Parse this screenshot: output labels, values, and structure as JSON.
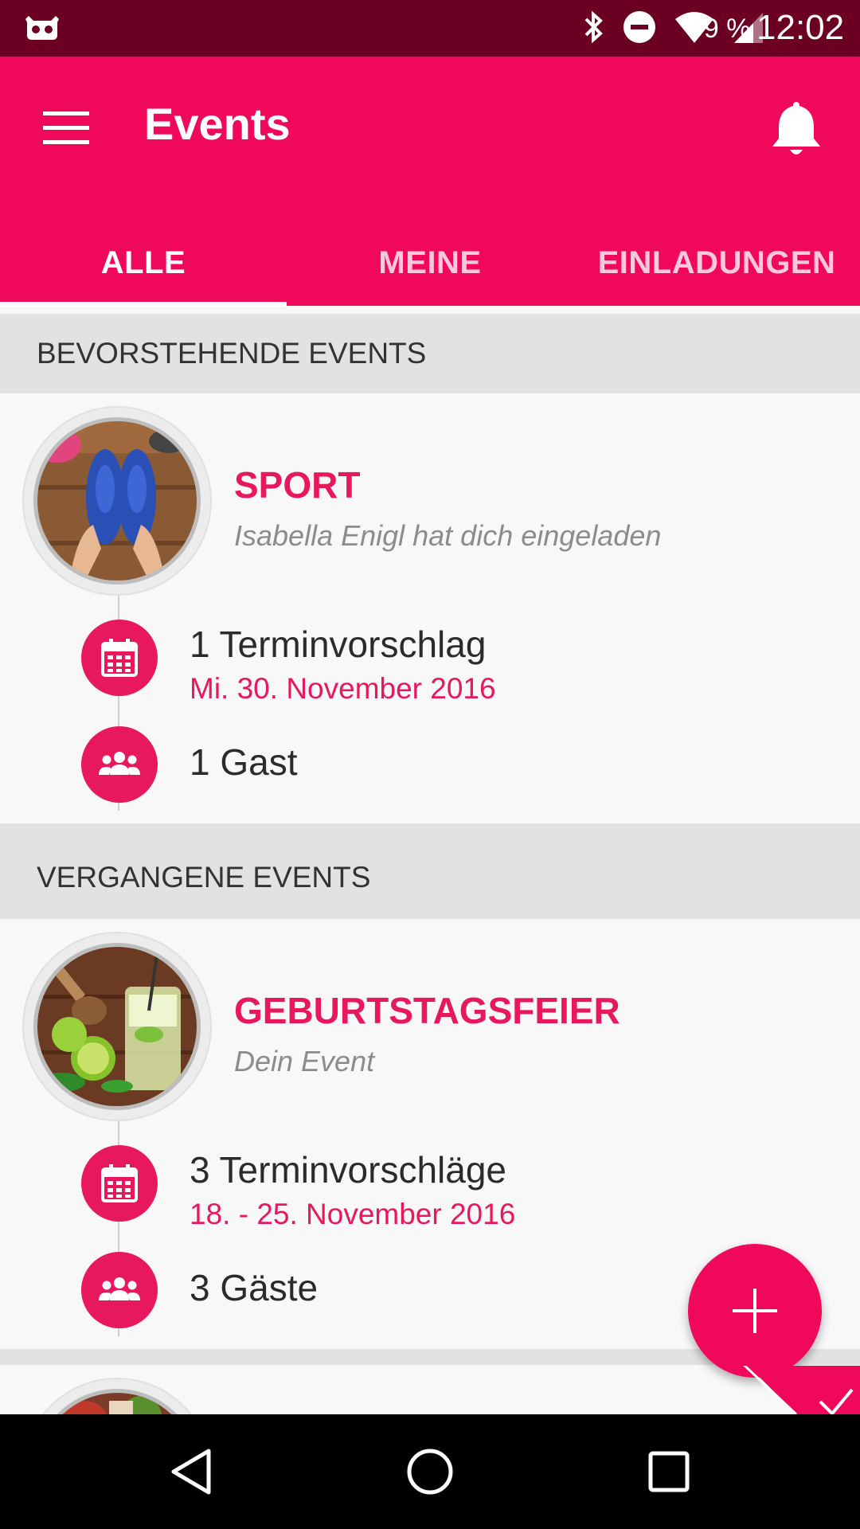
{
  "status_bar": {
    "battery_text": "99 %",
    "time": "12:02",
    "icons": [
      "cyanogen-icon",
      "bluetooth-icon",
      "do-not-disturb-icon",
      "wifi-icon",
      "cell-signal-icon"
    ]
  },
  "app_bar": {
    "title": "Events",
    "menu_icon": "hamburger-menu-icon",
    "notifications_icon": "bell-icon",
    "background": "#f0085a"
  },
  "tabs": [
    {
      "label": "ALLE",
      "active": true
    },
    {
      "label": "MEINE",
      "active": false
    },
    {
      "label": "EINLADUNGEN",
      "active": false
    }
  ],
  "sections": [
    {
      "header": "BEVORSTEHENDE EVENTS",
      "events": [
        {
          "title": "SPORT",
          "subtitle": "Isabella Enigl hat dich eingeladen",
          "dates_label": "1 Terminvorschlag",
          "dates_value": "Mi. 30. November 2016",
          "guests_label": "1 Gast",
          "image": "sneakers-photo"
        }
      ]
    },
    {
      "header": "VERGANGENE EVENTS",
      "events": [
        {
          "title": "GEBURTSTAGSFEIER",
          "subtitle": "Dein Event",
          "dates_label": "3 Terminvorschläge",
          "dates_value": "18. - 25. November 2016",
          "guests_label": "3 Gäste",
          "image": "mojito-drink-photo"
        }
      ]
    }
  ],
  "fab": {
    "icon": "plus-icon"
  },
  "colors": {
    "accent": "#e8185c",
    "status_bar": "#6b0022",
    "section_header_bg": "#e2e2e2"
  }
}
